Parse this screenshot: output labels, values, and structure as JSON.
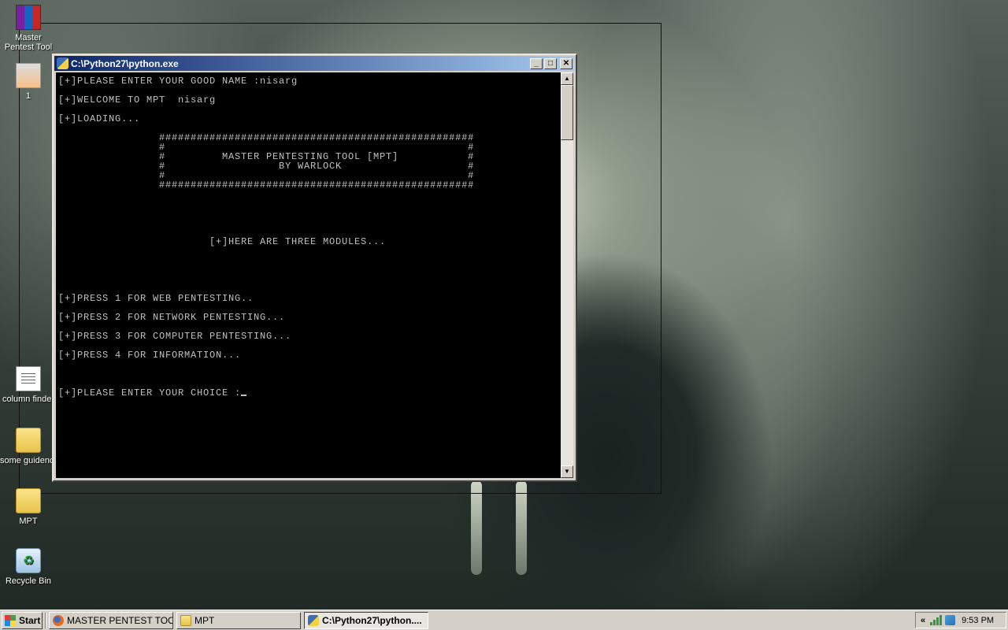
{
  "desktop": {
    "icons": [
      {
        "label": "Master\nPentest Tool",
        "icon": "winrar-archive-icon"
      },
      {
        "label": "1",
        "icon": "image-file-icon"
      },
      {
        "label": "column finder",
        "icon": "text-document-icon"
      },
      {
        "label": "some guidence",
        "icon": "folder-icon"
      },
      {
        "label": "MPT",
        "icon": "folder-icon"
      },
      {
        "label": "Recycle Bin",
        "icon": "recycle-bin-icon"
      }
    ]
  },
  "window": {
    "title": "C:\\Python27\\python.exe",
    "buttons": {
      "minimize": "_",
      "maximize": "□",
      "close": "✕"
    },
    "console_lines": [
      "[+]PLEASE ENTER YOUR GOOD NAME :nisarg",
      "",
      "[+]WELCOME TO MPT  nisarg",
      "",
      "[+]LOADING...",
      "",
      "                ##################################################",
      "                #                                                #",
      "                #         MASTER PENTESTING TOOL [MPT]           #",
      "                #                  BY WARLOCK                    #",
      "                #                                                #",
      "                ##################################################",
      "",
      "",
      "",
      "",
      "",
      "                        [+]HERE ARE THREE MODULES...",
      "",
      "",
      "",
      "",
      "",
      "[+]PRESS 1 FOR WEB PENTESTING..",
      "",
      "[+]PRESS 2 FOR NETWORK PENTESTING...",
      "",
      "[+]PRESS 3 FOR COMPUTER PENTESTING...",
      "",
      "[+]PRESS 4 FOR INFORMATION...",
      "",
      "",
      "",
      "[+]PLEASE ENTER YOUR CHOICE :"
    ],
    "scrollbar": {
      "up": "▲",
      "down": "▼"
    }
  },
  "taskbar": {
    "start_label": "Start",
    "tasks": [
      {
        "label": "MASTER PENTEST TOOL ...",
        "icon": "firefox-icon",
        "active": false
      },
      {
        "label": "MPT",
        "icon": "folder-icon",
        "active": false
      },
      {
        "label": "C:\\Python27\\python....",
        "icon": "python-icon",
        "active": true
      }
    ],
    "tray": {
      "chevron": "«",
      "time": "9:53 PM"
    }
  }
}
